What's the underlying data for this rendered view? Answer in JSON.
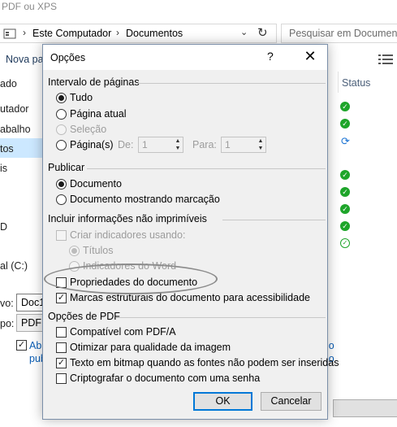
{
  "background_window": {
    "title": "PDF ou XPS",
    "address_bar": {
      "breadcrumbs": [
        "Este Computador",
        "Documentos"
      ],
      "separator": "›",
      "dropdown": "⌄",
      "refresh": "↻"
    },
    "search": {
      "placeholder": "Pesquisar em Documentos"
    },
    "toolbar": {
      "new_folder": "Nova pa"
    },
    "sidebar": [
      "ado",
      "utador",
      "abalho",
      "tos",
      "is",
      "D",
      "al (C:)"
    ],
    "columns": {
      "status": "Status"
    },
    "status_icons": [
      "check",
      "check",
      "sync",
      "check",
      "check",
      "check",
      "check",
      "check-outline"
    ],
    "filename": {
      "label": "vo:",
      "value": "Doc1"
    },
    "filetype": {
      "label": "po:",
      "value": "PDF ("
    },
    "open_after_publish": {
      "checked": true,
      "line1": "Abr",
      "line2": "pub"
    },
    "right_link": {
      "line1": "io",
      "line2": "io"
    }
  },
  "dialog": {
    "title": "Opções",
    "help": "?",
    "close": "✕",
    "page_range": {
      "heading": "Intervalo de páginas",
      "all": "Tudo",
      "current": "Página atual",
      "selection": "Seleção",
      "pages": "Página(s)",
      "from_label": "De:",
      "from_value": "1",
      "to_label": "Para:",
      "to_value": "1",
      "selected": "all"
    },
    "publish": {
      "heading": "Publicar",
      "document": "Documento",
      "markup": "Documento mostrando marcação",
      "selected": "document"
    },
    "non_printing": {
      "heading": "Incluir informações não imprimíveis",
      "create_bookmarks": "Criar indicadores usando:",
      "headings": "Títulos",
      "word_bookmarks": "Indicadores do Word",
      "document_properties": "Propriedades do documento",
      "document_properties_checked": false,
      "structure_tags": "Marcas estruturais do documento para acessibilidade",
      "structure_tags_checked": true
    },
    "pdf_options": {
      "heading": "Opções de PDF",
      "pdfa": "Compatível com PDF/A",
      "pdfa_checked": false,
      "optimize": "Otimizar para qualidade da imagem",
      "optimize_checked": false,
      "bitmap": "Texto em bitmap quando as fontes não podem ser inseridas",
      "bitmap_checked": true,
      "encrypt": "Criptografar o documento com uma senha",
      "encrypt_checked": false
    },
    "buttons": {
      "ok": "OK",
      "cancel": "Cancelar"
    },
    "glyphs": {
      "check": "✓",
      "spin_up": "▲",
      "spin_down": "▼"
    }
  }
}
